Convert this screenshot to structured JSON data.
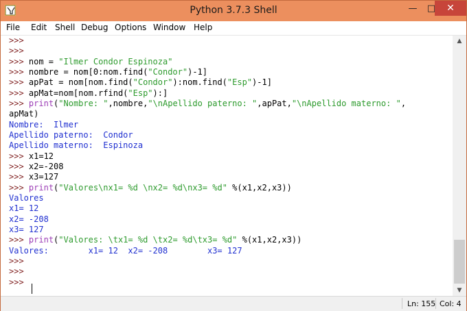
{
  "window": {
    "title": "Python 3.7.3 Shell",
    "controls": {
      "minimize": "—",
      "maximize": "□",
      "close": "✕"
    }
  },
  "menu": [
    "File",
    "Edit",
    "Shell",
    "Debug",
    "Options",
    "Window",
    "Help"
  ],
  "shell": {
    "prompt": ">>>",
    "lines": [
      ">>>",
      ">>>",
      ">>> nom = \"Ilmer Condor Espinoza\"",
      ">>> nombre = nom[0:nom.find(\"Condor\")-1]",
      ">>> apPat = nom[nom.find(\"Condor\"):nom.find(\"Esp\")-1]",
      ">>> apMat=nom[nom.rfind(\"Esp\"):]",
      ">>> print(\"Nombre: \",nombre,\"\\nApellido paterno: \",apPat,\"\\nApellido materno: \",",
      "apMat)",
      "Nombre:  Ilmer",
      "Apellido paterno:  Condor",
      "Apellido materno:  Espinoza",
      ">>> x1=12",
      ">>> x2=-208",
      ">>> x3=127",
      ">>> print(\"Valores\\nx1= %d \\nx2= %d\\nx3= %d\" %(x1,x2,x3))",
      "Valores",
      "x1= 12",
      "x2= -208",
      "x3= 127",
      ">>> print(\"Valores: \\tx1= %d \\tx2= %d\\tx3= %d\" %(x1,x2,x3))",
      "Valores:        x1= 12  x2= -208        x3= 127",
      ">>>",
      ">>>",
      ">>>"
    ]
  },
  "status": {
    "ln": "Ln: 155",
    "col": "Col: 4"
  },
  "colors": {
    "titlebar": "#ec8f5e",
    "close_button": "#c7453a",
    "prompt": "#7f1f1f",
    "string": "#2c9a2c",
    "builtin": "#9b3bb5",
    "output": "#1f2fd0"
  },
  "icons": {
    "app": "python-idle-icon",
    "scroll_up": "scroll-up-arrow-icon",
    "scroll_down": "scroll-down-arrow-icon"
  }
}
